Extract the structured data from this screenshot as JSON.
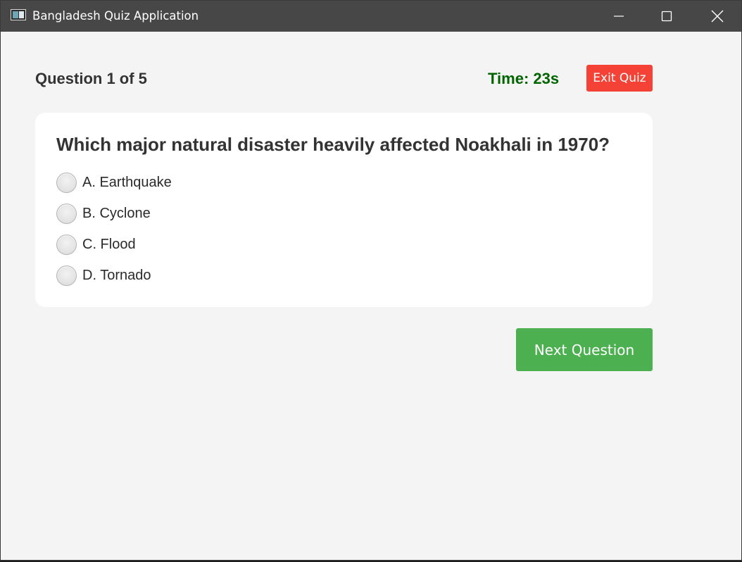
{
  "window": {
    "title": "Bangladesh Quiz Application",
    "icons": {
      "app": "app-window-icon",
      "minimize": "minimize-icon",
      "maximize": "maximize-icon",
      "close": "close-icon"
    }
  },
  "quiz": {
    "progress_label": "Question 1 of 5",
    "timer_label": "Time: 23s",
    "exit_label": "Exit Quiz",
    "question": "Which major natural disaster heavily affected Noakhali in 1970?",
    "options": [
      {
        "label": "A. Earthquake",
        "selected": false
      },
      {
        "label": "B. Cyclone",
        "selected": false
      },
      {
        "label": "C. Flood",
        "selected": false
      },
      {
        "label": "D. Tornado",
        "selected": false
      }
    ],
    "next_label": "Next Question"
  },
  "colors": {
    "titlebar": "#474747",
    "background": "#f4f4f4",
    "timer": "#006400",
    "exit_button": "#f44336",
    "next_button": "#4caf50"
  }
}
